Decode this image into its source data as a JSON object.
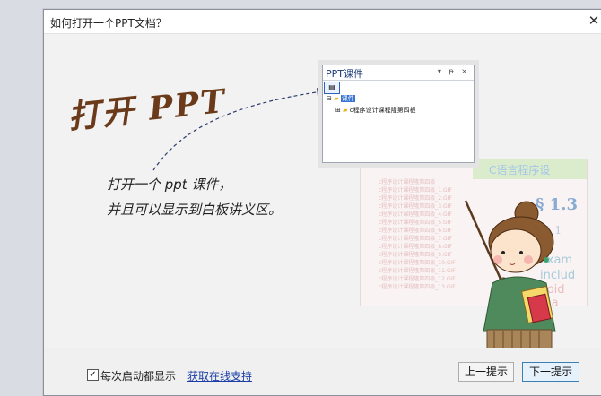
{
  "dialog": {
    "title": "如何打开一个PPT文档？",
    "close_glyph": "✕"
  },
  "content": {
    "headline": "打开 PPT",
    "desc_line1": "打开一个 ppt 课件，",
    "desc_line2": "并且可以显示到白板讲义区。"
  },
  "panel": {
    "title": "PPT课件",
    "controls": "▾ ᵽ ×",
    "tree_root": "课件",
    "tree_child": "c程序设计课程隆第四板"
  },
  "ghost": {
    "header": "C语言程序设",
    "big": "§ 1.3",
    "mid": "1.1",
    "w1": "exam",
    "w2": "includ",
    "w3": "void ma",
    "list_title": "c程序设计课程隆第四板",
    "list_items": [
      "c程序设计课程隆第四板_1.GIF",
      "c程序设计课程隆第四板_2.GIF",
      "c程序设计课程隆第四板_3.GIF",
      "c程序设计课程隆第四板_4.GIF",
      "c程序设计课程隆第四板_5.GIF",
      "c程序设计课程隆第四板_6.GIF",
      "c程序设计课程隆第四板_7.GIF",
      "c程序设计课程隆第四板_8.GIF",
      "c程序设计课程隆第四板_9.GIF",
      "c程序设计课程隆第四板_10.GIF",
      "c程序设计课程隆第四板_11.GIF",
      "c程序设计课程隆第四板_12.GIF",
      "c程序设计课程隆第四板_13.GIF"
    ]
  },
  "footer": {
    "checkbox_checked": "✓",
    "checkbox_label": "每次启动都显示",
    "support_link": "获取在线支持",
    "prev_button": "上一提示",
    "next_button": "下一提示"
  }
}
